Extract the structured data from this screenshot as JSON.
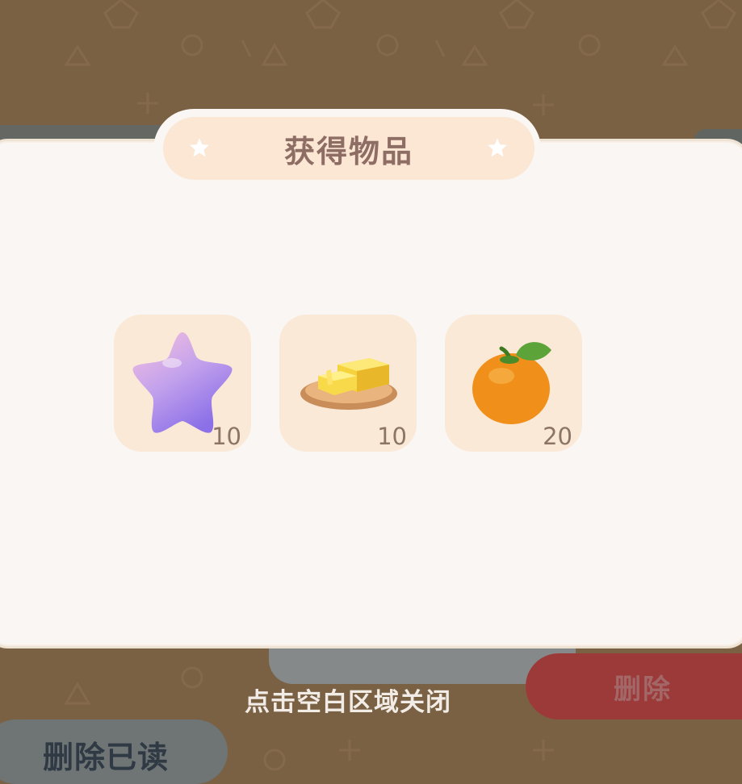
{
  "dialog": {
    "title": "获得物品",
    "close_hint": "点击空白区域关闭"
  },
  "rewards": [
    {
      "icon": "purple-star-icon",
      "count": "10"
    },
    {
      "icon": "butter-icon",
      "count": "10"
    },
    {
      "icon": "orange-icon",
      "count": "20"
    }
  ],
  "background": {
    "delete_label": "删除",
    "delete_read_label": "删除已读"
  },
  "colors": {
    "backdrop": "#7a6144",
    "dialog": "#faf6f3",
    "title_pill": "#fbe7d3",
    "title_text": "#8e6d65",
    "slot": "#fbe9d7",
    "delete_button": "#9c3a3a"
  }
}
